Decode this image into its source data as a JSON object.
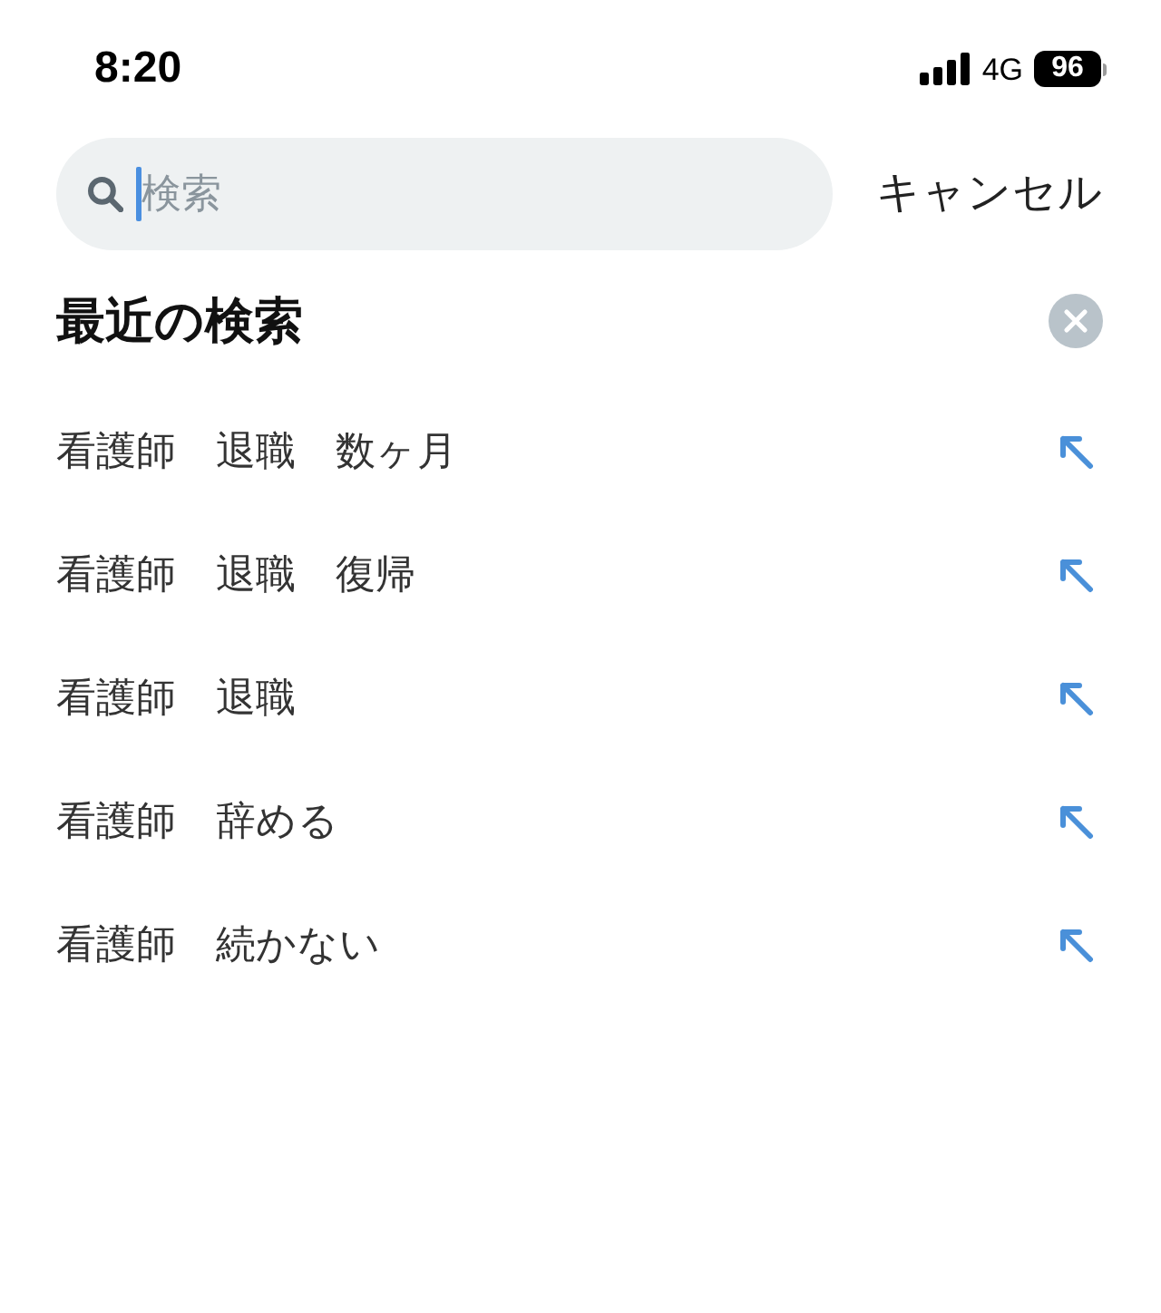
{
  "status_bar": {
    "time": "8:20",
    "network": "4G",
    "battery": "96"
  },
  "search": {
    "placeholder": "検索",
    "focused": true,
    "cancel": "キャンセル"
  },
  "recent": {
    "title": "最近の検索",
    "items": [
      {
        "query": "看護師　退職　数ヶ月"
      },
      {
        "query": "看護師　退職　復帰"
      },
      {
        "query": "看護師　退職"
      },
      {
        "query": "看護師　辞める"
      },
      {
        "query": "看護師　続かない"
      }
    ]
  }
}
